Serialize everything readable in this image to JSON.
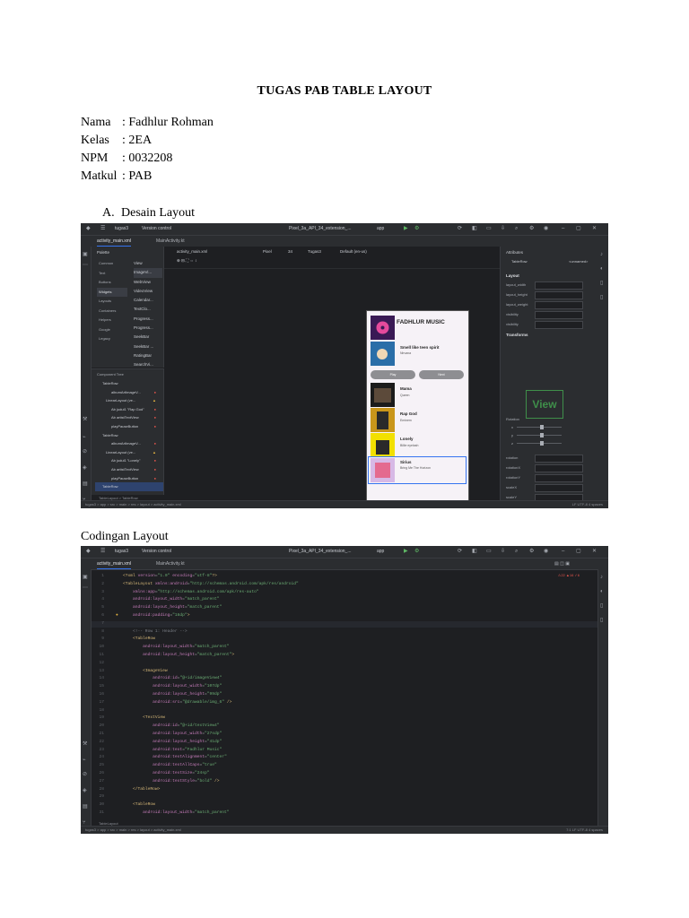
{
  "document": {
    "title": "TUGAS PAB TABLE LAYOUT",
    "info": [
      {
        "key": "Nama",
        "value": ": Fadhlur Rohman"
      },
      {
        "key": "Kelas",
        "value": ": 2EA"
      },
      {
        "key": "NPM",
        "value": ": 0032208"
      },
      {
        "key": "Matkul",
        "value": ": PAB"
      }
    ],
    "section_a": {
      "number": "A.",
      "label": "Desain Layout"
    },
    "section_b": {
      "label": "Codingan Layout"
    }
  },
  "ide": {
    "project": "tugas3",
    "vcs": "Version control",
    "device": "Pixel_3a_API_34_extension_...",
    "run_config": "app",
    "tabs": [
      "activity_main.xml",
      "MainActivity.kt"
    ]
  },
  "design": {
    "palette_title": "Palette",
    "palette_categories": [
      "Common",
      "Text",
      "Buttons",
      "Widgets",
      "Layouts",
      "Containers",
      "Helpers",
      "Google",
      "Legacy"
    ],
    "palette_items": [
      "View",
      "ImageVi...",
      "WebView",
      "VideoView",
      "Calendar...",
      "TextClo...",
      "Progress...",
      "Progress...",
      "SeekBar",
      "SeekBar ...",
      "RatingBar",
      "SearchVi..."
    ],
    "canvas_toolbar": {
      "file": "activity_main.xml",
      "device": "Pixel",
      "api": "34",
      "theme": "Tugas3",
      "locale": "Default (en-us)"
    },
    "component_tree_title": "Component Tree",
    "component_tree": [
      {
        "label": "TableRow",
        "badge": ""
      },
      {
        "label": "albumArtImageV...",
        "badge": "err"
      },
      {
        "label": "LinearLayout (ve...",
        "badge": "warn"
      },
      {
        "label": "Ab judul1 \"Rap God\"",
        "badge": "err"
      },
      {
        "label": "Ab artistTextView",
        "badge": "err"
      },
      {
        "label": "playPauseButton",
        "badge": "err"
      },
      {
        "label": "TableRow",
        "badge": ""
      },
      {
        "label": "albumArtImageV...",
        "badge": "err"
      },
      {
        "label": "LinearLayout (ve...",
        "badge": "warn"
      },
      {
        "label": "Ab judul1 \"Lonely\"",
        "badge": "err"
      },
      {
        "label": "Ab artistTextView",
        "badge": "err"
      },
      {
        "label": "playPauseButton",
        "badge": "err"
      },
      {
        "label": "TableRow",
        "badge": ""
      }
    ],
    "bottom_breadcrumb": "TableLayout > TableRow",
    "status_path": "tugas3 > app > src > main > res > layout > activity_main.xml",
    "status_right": "LF  UTF-8  4 spaces",
    "phone": {
      "header": "FADHLUR MUSIC",
      "songs": [
        {
          "title": "Smell like teen spirit",
          "artist": "Nirvana"
        },
        {
          "title": "Mama",
          "artist": "Queen"
        },
        {
          "title": "Rap God",
          "artist": "Eminem"
        },
        {
          "title": "Lonely",
          "artist": "Billie eyelash"
        },
        {
          "title": "Sirius",
          "artist": "Bring Me The Horizon"
        }
      ],
      "buttons": [
        "Play",
        "Next"
      ]
    },
    "attributes": {
      "title": "Attributes",
      "selected": "TableRow",
      "selected_type": "<unnamed>",
      "layout_section": "Layout",
      "rows": [
        "layout_width",
        "layout_height",
        "layout_weight",
        "visibility",
        "visibility"
      ],
      "transforms": "Transforms",
      "preview_label": "View",
      "rotation_label": "Rotation",
      "rotation_axes": [
        "x",
        "y",
        "z"
      ],
      "transform_fields": [
        "rotation",
        "rotationX",
        "rotationY",
        "scaleX",
        "scaleY"
      ]
    }
  },
  "code": {
    "line_numbers": [
      "1",
      "2",
      "3",
      "4",
      "5",
      "6",
      "7",
      "8",
      "9",
      "10",
      "11",
      "12",
      "13",
      "14",
      "15",
      "16",
      "17",
      "18",
      "19",
      "20",
      "21",
      "22",
      "23",
      "24",
      "25",
      "26",
      "27",
      "28",
      "29",
      "30",
      "31",
      "32",
      "33",
      "34",
      "35",
      "36"
    ],
    "lines": [
      "<?xml version=\"1.0\" encoding=\"utf-8\"?>",
      "<TableLayout xmlns:android=\"http://schemas.android.com/apk/res/android\"",
      "    xmlns:app=\"http://schemas.android.com/apk/res-auto\"",
      "    android:layout_width=\"match_parent\"",
      "    android:layout_height=\"match_parent\"",
      "    android:padding=\"16dp\">",
      "",
      "    <!-- Row 1: Header -->",
      "    <TableRow",
      "        android:layout_width=\"match_parent\"",
      "        android:layout_height=\"match_parent\">",
      "",
      "        <ImageView",
      "            android:id=\"@+id/imageView4\"",
      "            android:layout_width=\"107dp\"",
      "            android:layout_height=\"99dp\"",
      "            android:src=\"@drawable/img_6\" />",
      "",
      "        <TextView",
      "            android:id=\"@+id/textView4\"",
      "            android:layout_width=\"27sdp\"",
      "            android:layout_height=\"41dp\"",
      "            android:text=\"Fadhlur Music\"",
      "            android:textAlignment=\"center\"",
      "            android:textAllCaps=\"true\"",
      "            android:textSize=\"24sp\"",
      "            android:textStyle=\"bold\" />",
      "    </TableRow>",
      "",
      "    <TableRow",
      "        android:layout_width=\"match_parent\""
    ],
    "inspections": "⚠22  ▲16  ✓6",
    "bottom_breadcrumb": "TableLayout",
    "status_path": "tugas3 > app > src > main > res > layout > activity_main.xml",
    "status_right": "7:1  LF  UTF-8  4 spaces"
  },
  "colors": {
    "ide_bg": "#1e1f22",
    "panel_bg": "#2b2d30",
    "accent": "#3574f0",
    "error": "#e5554d",
    "warning": "#e3b341",
    "xml_tag": "#d5b778",
    "xml_attr": "#c77dbb",
    "xml_string": "#6aab73"
  }
}
